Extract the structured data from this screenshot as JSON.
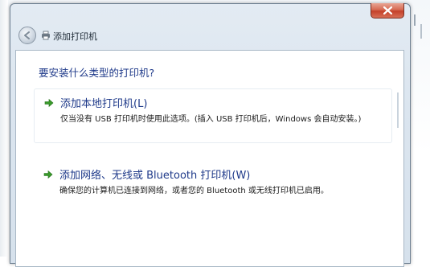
{
  "window": {
    "title": "添加打印机"
  },
  "content": {
    "heading": "要安装什么类型的打印机?",
    "options": [
      {
        "title": "添加本地打印机(L)",
        "description": "仅当没有 USB 打印机时使用此选项。(插入 USB 打印机后，Windows 会自动安装。)",
        "icon": "green-arrow-icon"
      },
      {
        "title": "添加网络、无线或 Bluetooth 打印机(W)",
        "description": "确保您的计算机已连接到网络，或者您的 Bluetooth 或无线打印机已启用。",
        "icon": "green-arrow-icon"
      }
    ]
  },
  "icons": {
    "close": "close-icon",
    "back": "back-arrow-icon",
    "app": "printer-icon"
  },
  "colors": {
    "link_blue": "#1f3a8a",
    "close_red": "#c4412a",
    "arrow_green": "#3a9a2a"
  }
}
